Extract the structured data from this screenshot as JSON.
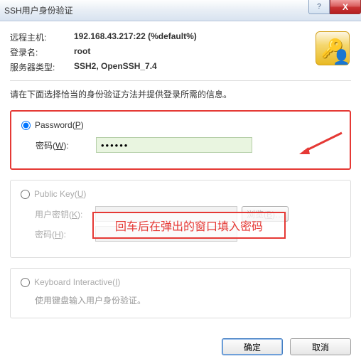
{
  "title": "SSH用户身份验证",
  "info": {
    "host_label": "远程主机:",
    "host_value": "192.168.43.217:22 (%default%)",
    "login_label": "登录名:",
    "login_value": "root",
    "server_label": "服务器类型:",
    "server_value": "SSH2, OpenSSH_7.4"
  },
  "instruction": "请在下面选择恰当的身份验证方法并提供登录所需的信息。",
  "methods": {
    "password": {
      "label": "Password(P)",
      "pwd_label": "密码(W):",
      "pwd_value": "••••••"
    },
    "pubkey": {
      "label": "Public Key(U)",
      "userkey_label": "用户密钥(K):",
      "browse_label": "浏览(B)…",
      "pass_label": "密码(H):"
    },
    "kbi": {
      "label": "Keyboard Interactive(I)",
      "desc": "使用键盘输入用户身份验证。"
    }
  },
  "annotation": "回车后在弹出的窗口填入密码",
  "buttons": {
    "ok": "确定",
    "cancel": "取消",
    "help": "?",
    "close": "X"
  }
}
